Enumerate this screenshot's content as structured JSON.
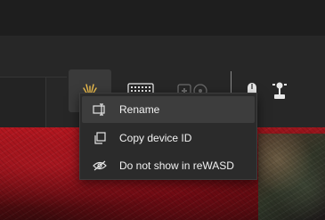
{
  "context_menu": {
    "items": [
      {
        "label": "Rename",
        "icon": "rename-icon"
      },
      {
        "label": "Copy device ID",
        "icon": "copy-icon"
      },
      {
        "label": "Do not show in reWASD",
        "icon": "eye-off-icon"
      }
    ]
  },
  "devices": [
    {
      "name": "virtual-device",
      "icon": "sparkle-icon",
      "selected": true
    },
    {
      "name": "keyboard",
      "icon": "keyboard-icon",
      "selected": false
    },
    {
      "name": "controller",
      "icon": "controller-icon",
      "selected": false
    },
    {
      "name": "mouse",
      "icon": "mouse-icon",
      "selected": false
    },
    {
      "name": "joystick",
      "icon": "joystick-icon",
      "selected": false
    }
  ],
  "colors": {
    "toolbar_bg": "#272727",
    "menu_bg": "#2b2b2b",
    "menu_hover": "#3d3d3d",
    "sparkle": "#f2c14e"
  }
}
